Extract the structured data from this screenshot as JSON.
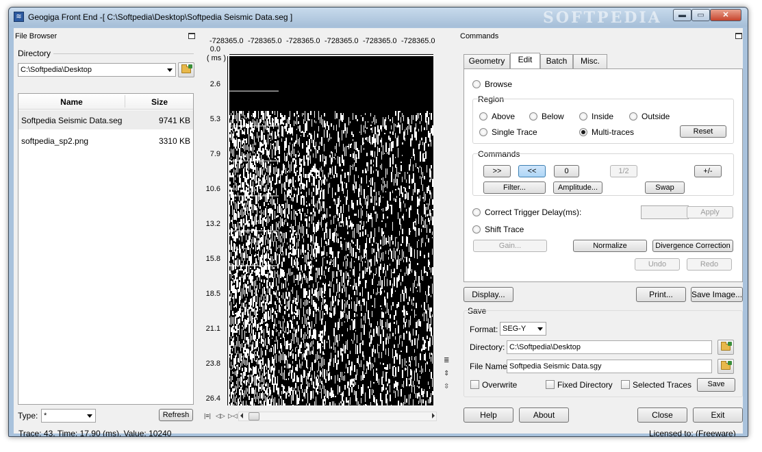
{
  "window": {
    "title": "Geogiga Front End -[ C:\\Softpedia\\Desktop\\Softpedia Seismic Data.seg ]",
    "watermark": "SOFTPEDIA",
    "min_glyph": "▬",
    "max_glyph": "▭",
    "close_glyph": "✕"
  },
  "file_browser": {
    "title": "File Browser",
    "directory_label": "Directory",
    "directory_value": "C:\\Softpedia\\Desktop",
    "columns": {
      "name": "Name",
      "size": "Size"
    },
    "files": [
      {
        "name": "Softpedia Seismic Data.seg",
        "size": "9741 KB"
      },
      {
        "name": "softpedia_sp2.png",
        "size": "3310 KB"
      }
    ],
    "type_label": "Type:",
    "type_value": "*",
    "refresh_label": "Refresh"
  },
  "plot": {
    "x_ticks": [
      "-728365.0",
      "-728365.0",
      "-728365.0",
      "-728365.0",
      "-728365.0",
      "-728365.0"
    ],
    "y_unit": "( ms )",
    "y_ticks": [
      "0.0",
      "2.6",
      "5.3",
      "7.9",
      "10.6",
      "13.2",
      "15.8",
      "18.5",
      "21.1",
      "23.8",
      "26.4"
    ],
    "nav_glyphs": [
      "|≡|",
      "◁▷",
      "▷◁"
    ]
  },
  "commands": {
    "title": "Commands",
    "tabs": [
      "Geometry",
      "Edit",
      "Batch",
      "Misc."
    ],
    "active_tab": "Edit",
    "browse_label": "Browse",
    "region_label": "Region",
    "region_options": {
      "above": "Above",
      "below": "Below",
      "inside": "Inside",
      "outside": "Outside",
      "single_trace": "Single Trace",
      "multi_traces": "Multi-traces"
    },
    "reset_label": "Reset",
    "commands_label": "Commands",
    "cmd_buttons": {
      "next": ">>",
      "prev": "<<",
      "zero": "0",
      "half": "1/2",
      "plus_minus": "+/-",
      "filter": "Filter...",
      "amplitude": "Amplitude...",
      "swap": "Swap"
    },
    "correct_trigger_label": "Correct Trigger Delay(ms):",
    "apply_label": "Apply",
    "shift_trace_label": "Shift Trace",
    "gain_label": "Gain...",
    "normalize_label": "Normalize",
    "divergence_label": "Divergence Correction",
    "undo_label": "Undo",
    "redo_label": "Redo"
  },
  "actions": {
    "display": "Display...",
    "print": "Print...",
    "save_image": "Save Image..."
  },
  "save": {
    "title": "Save",
    "format_label": "Format:",
    "format_value": "SEG-Y",
    "directory_label": "Directory:",
    "directory_value": "C:\\Softpedia\\Desktop",
    "filename_label": "File Name:",
    "filename_value": "Softpedia Seismic Data.sgy",
    "overwrite_label": "Overwrite",
    "fixed_dir_label": "Fixed Directory",
    "selected_traces_label": "Selected Traces",
    "save_button": "Save"
  },
  "footer": {
    "help": "Help",
    "about": "About",
    "close": "Close",
    "exit": "Exit",
    "status": "Trace: 43, Time: 17.90 (ms), Value: 10240",
    "license": "Licensed to: (Freeware)"
  }
}
